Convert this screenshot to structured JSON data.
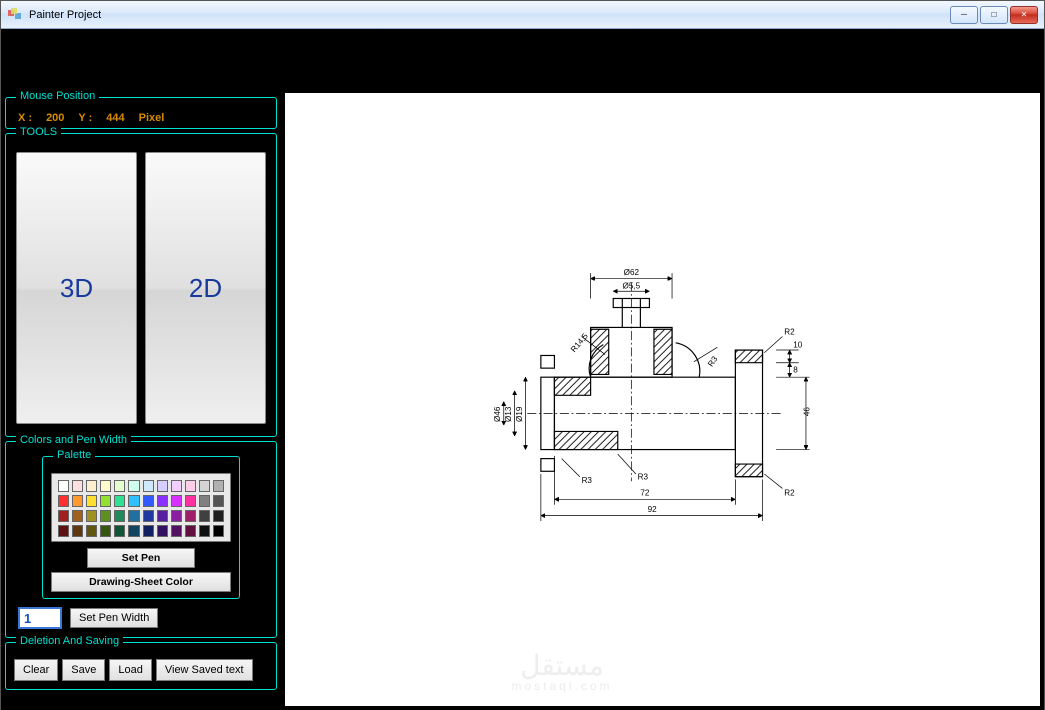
{
  "window": {
    "title": "Painter Project",
    "min_glyph": "—",
    "max_glyph": "☐",
    "close_glyph": "✕"
  },
  "mouse": {
    "legend": "Mouse Position",
    "x_label": "X :",
    "x_value": "200",
    "y_label": "Y :",
    "y_value": "444",
    "unit": "Pixel"
  },
  "tools": {
    "legend": "TOOLS",
    "btn_3d": "3D",
    "btn_2d": "2D"
  },
  "colors": {
    "legend_outer": "Colors and Pen Width",
    "legend_palette": "Palette",
    "set_pen": "Set Pen",
    "drawing_sheet": "Drawing-Sheet Color",
    "pen_width_value": "1",
    "set_pen_width": "Set Pen Width",
    "palette_rows": [
      [
        "#ffffff",
        "#ffe0e0",
        "#ffefcf",
        "#fffbcf",
        "#e6ffcf",
        "#cfffee",
        "#cfeaff",
        "#d7cfff",
        "#f1cfff",
        "#ffcfea",
        "#d4d4d4",
        "#b0b0b0"
      ],
      [
        "#ff3030",
        "#ff9a30",
        "#ffe030",
        "#93e030",
        "#30e093",
        "#30c0ff",
        "#305aff",
        "#8a30ff",
        "#d830ff",
        "#ff30a0",
        "#808080",
        "#555555"
      ],
      [
        "#a02020",
        "#a06020",
        "#a09020",
        "#5c9020",
        "#208a5c",
        "#2070a0",
        "#2038a0",
        "#5820a0",
        "#8a20a0",
        "#a02068",
        "#404040",
        "#202020"
      ],
      [
        "#601010",
        "#603810",
        "#605610",
        "#365610",
        "#105636",
        "#104460",
        "#102060",
        "#341060",
        "#541060",
        "#60103e",
        "#101010",
        "#000000"
      ]
    ]
  },
  "actions": {
    "legend": "Deletion And Saving",
    "clear": "Clear",
    "save": "Save",
    "load": "Load",
    "view_saved": "View Saved text"
  },
  "watermark": {
    "big": "مستقل",
    "small": "mostaql.com"
  },
  "drawing": {
    "dims": {
      "d62": "Ø62",
      "d55": "Ø5,5",
      "ten": "10",
      "eight": "8",
      "r145": "R14,5",
      "r3a": "R3",
      "r3b": "R3",
      "r3c": "R3",
      "r2a": "R2",
      "r2b": "R2",
      "d46": "Ø46",
      "d13": "Ø13",
      "d19": "Ø19",
      "len72": "72",
      "len92": "92",
      "h46": "46"
    }
  }
}
